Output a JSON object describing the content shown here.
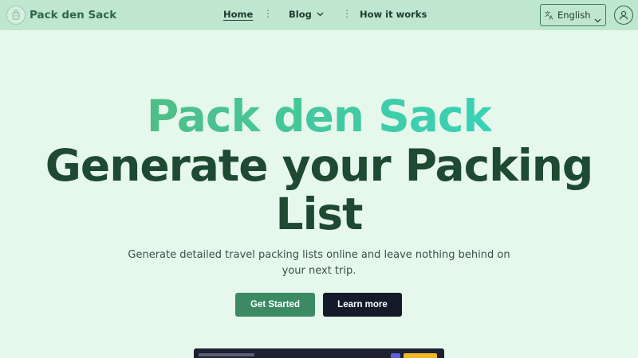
{
  "brand": {
    "name": "Pack den Sack",
    "logo_icon": "backpack-logo-icon"
  },
  "nav": {
    "items": [
      {
        "label": "Home",
        "active": true
      },
      {
        "label": "Blog",
        "has_dropdown": true
      },
      {
        "label": "How it works"
      }
    ],
    "separator": "⋮"
  },
  "language": {
    "icon": "translate-icon",
    "label": "English"
  },
  "account": {
    "icon": "user-icon"
  },
  "hero": {
    "title_line1": "Pack den Sack",
    "title_line2": "Generate your Packing",
    "title_line3": "List",
    "subtitle": "Generate detailed travel packing lists online and leave nothing behind on your next trip."
  },
  "buttons": {
    "get_started": "Get Started",
    "learn_more": "Learn more"
  },
  "colors": {
    "page_bg": "#e6f7ec",
    "header_bg": "#bfe6cf",
    "brand_green": "#2c6848",
    "gradient_start": "#4fbe86",
    "gradient_end": "#38d2b8",
    "primary_button": "#3b8a63",
    "secondary_button": "#141a2a"
  }
}
